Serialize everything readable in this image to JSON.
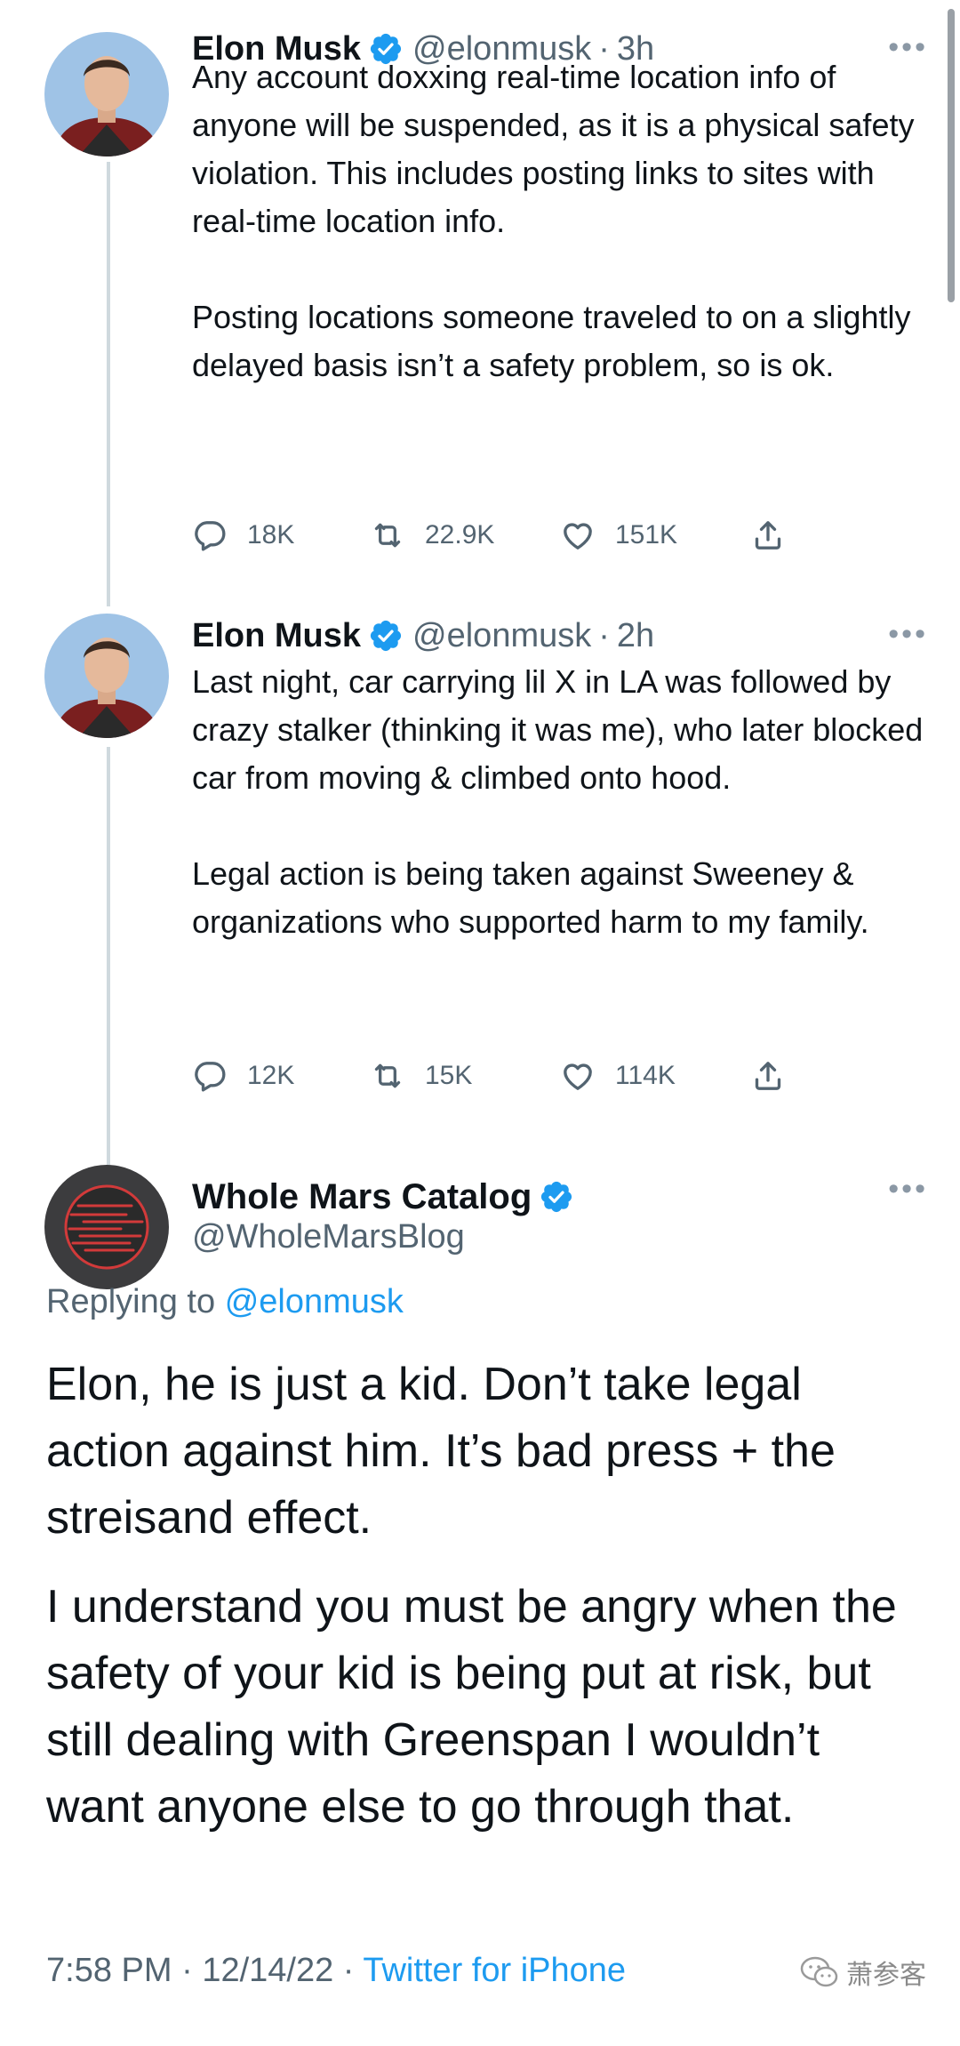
{
  "thread": [
    {
      "author_name": "Elon Musk",
      "handle": "@elonmusk",
      "time": "3h",
      "paragraphs": [
        "Any account doxxing real-time location info of anyone will be suspended, as it is a physical safety violation. This includes posting links to sites with real-time location info.",
        "Posting locations someone traveled to on a slightly delayed basis isn’t a safety problem, so is ok."
      ],
      "replies": "18K",
      "retweets": "22.9K",
      "likes": "151K"
    },
    {
      "author_name": "Elon Musk",
      "handle": "@elonmusk",
      "time": "2h",
      "paragraphs": [
        "Last night, car carrying lil X in LA was followed by crazy stalker (thinking it was me), who later blocked car from moving & climbed onto hood.",
        "Legal action is being taken against Sweeney & organizations who supported harm to my family."
      ],
      "replies": "12K",
      "retweets": "15K",
      "likes": "114K"
    }
  ],
  "main_tweet": {
    "author_name": "Whole Mars Catalog",
    "handle": "@WholeMarsBlog",
    "replying_prefix": "Replying to",
    "replying_to": "@elonmusk",
    "paragraphs": [
      "Elon, he is just a kid. Don’t take legal action against him. It’s bad press + the streisand effect.",
      "I understand you must be angry when the safety of your kid is being put at risk, but still dealing with Greenspan I wouldn’t want anyone else to go through that."
    ],
    "time": "7:58 PM",
    "date": "12/14/22",
    "source": "Twitter for iPhone"
  },
  "ui": {
    "separator": "·",
    "more": "•••",
    "watermark_text": "萧参客"
  },
  "colors": {
    "accent_blue": "#1d9bf0",
    "secondary_text": "#536471",
    "primary_text": "#0f1419"
  },
  "icons": [
    "verified-badge-icon",
    "reply-icon",
    "retweet-icon",
    "like-icon",
    "share-icon",
    "more-icon",
    "wechat-icon"
  ]
}
